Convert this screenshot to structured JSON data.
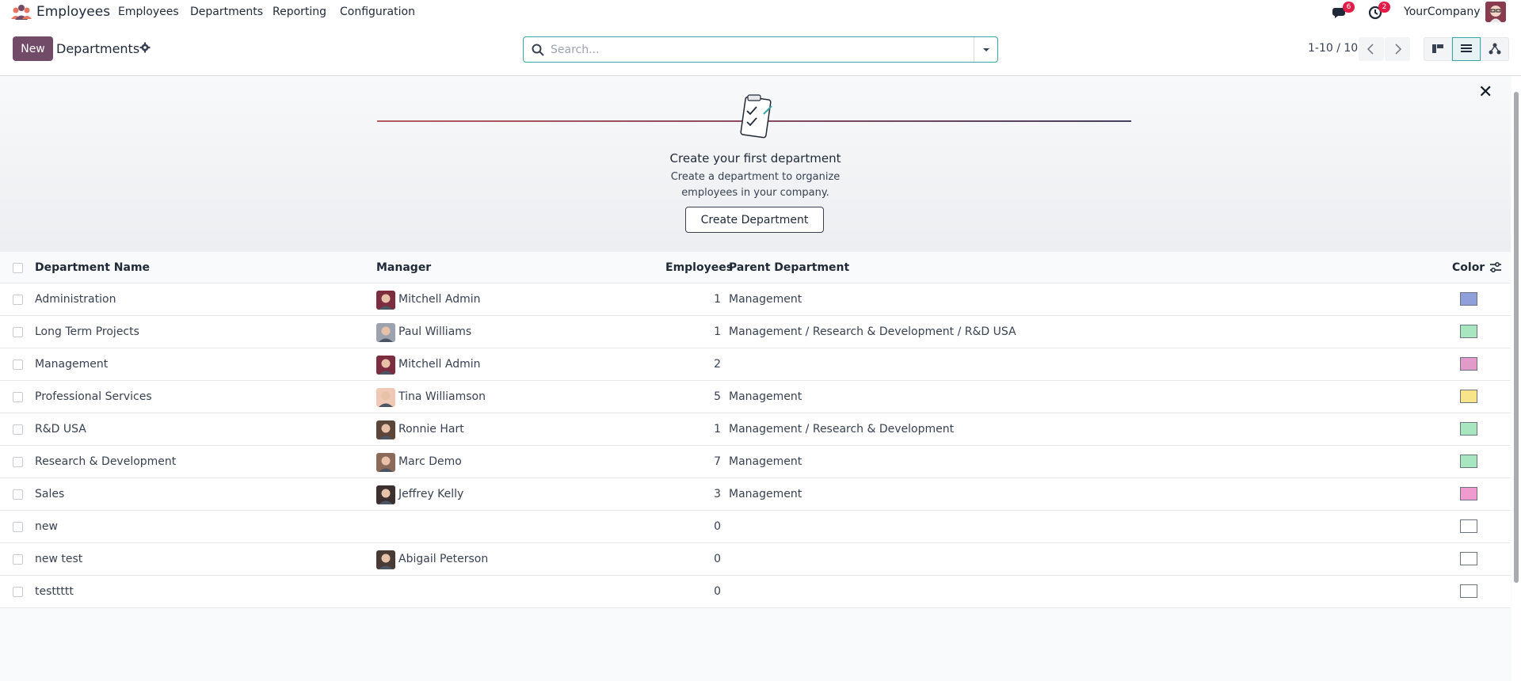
{
  "topnav": {
    "app_name": "Employees",
    "menu": [
      "Employees",
      "Departments",
      "Reporting",
      "Configuration"
    ],
    "messages_badge": "6",
    "activities_badge": "2",
    "company": "YourCompany"
  },
  "control": {
    "new_label": "New",
    "title": "Departments",
    "search_placeholder": "Search...",
    "pager": "1-10 / 10"
  },
  "helper": {
    "title": "Create your first department",
    "line1": "Create a department to organize",
    "line2": "employees in your company.",
    "button": "Create Department"
  },
  "table": {
    "headers": {
      "name": "Department Name",
      "manager": "Manager",
      "employees": "Employees",
      "parent": "Parent Department",
      "color": "Color"
    },
    "rows": [
      {
        "name": "Administration",
        "manager": "Mitchell Admin",
        "employees": "1",
        "parent": "Management",
        "color": "#8f9fd9"
      },
      {
        "name": "Long Term Projects",
        "manager": "Paul Williams",
        "employees": "1",
        "parent": "Management / Research & Development / R&D USA",
        "color": "#a8e6c0"
      },
      {
        "name": "Management",
        "manager": "Mitchell Admin",
        "employees": "2",
        "parent": "",
        "color": "#e29bc9"
      },
      {
        "name": "Professional Services",
        "manager": "Tina Williamson",
        "employees": "5",
        "parent": "Management",
        "color": "#f8e58a"
      },
      {
        "name": "R&D USA",
        "manager": "Ronnie Hart",
        "employees": "1",
        "parent": "Management / Research & Development",
        "color": "#a8e6c0"
      },
      {
        "name": "Research & Development",
        "manager": "Marc Demo",
        "employees": "7",
        "parent": "Management",
        "color": "#a8e6c0"
      },
      {
        "name": "Sales",
        "manager": "Jeffrey Kelly",
        "employees": "3",
        "parent": "Management",
        "color": "#f09bd0"
      },
      {
        "name": "new",
        "manager": "",
        "employees": "0",
        "parent": "",
        "color": "#ffffff"
      },
      {
        "name": "new test",
        "manager": "Abigail Peterson",
        "employees": "0",
        "parent": "",
        "color": "#ffffff"
      },
      {
        "name": "testtttt",
        "manager": "",
        "employees": "0",
        "parent": "",
        "color": "#ffffff"
      }
    ]
  }
}
